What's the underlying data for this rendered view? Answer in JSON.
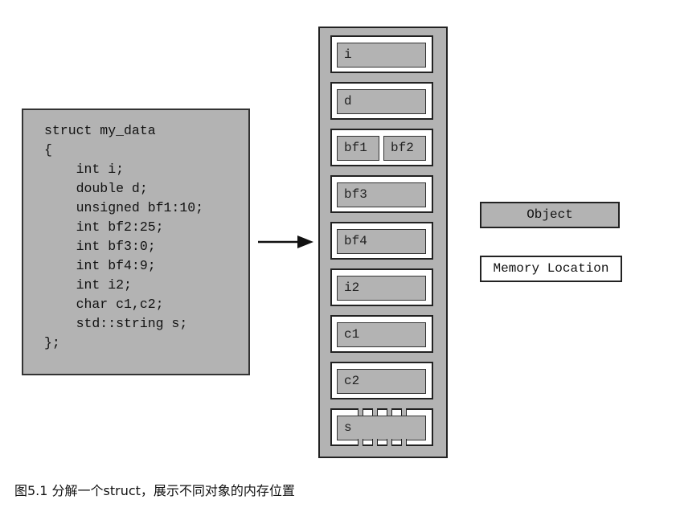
{
  "code_lines": [
    "struct my_data",
    "{",
    "    int i;",
    "    double d;",
    "    unsigned bf1:10;",
    "    int bf2:25;",
    "    int bf3:0;",
    "    int bf4:9;",
    "    int i2;",
    "    char c1,c2;",
    "    std::string s;",
    "};"
  ],
  "memory_slots": [
    [
      "i"
    ],
    [
      "d"
    ],
    [
      "bf1",
      "bf2"
    ],
    [
      "bf3"
    ],
    [
      "bf4"
    ],
    [
      "i2"
    ],
    [
      "c1"
    ],
    [
      "c2"
    ],
    [
      "s"
    ]
  ],
  "legend": {
    "object": "Object",
    "memory_location": "Memory Location"
  },
  "caption": "图5.1 分解一个struct，展示不同对象的内存位置",
  "colors": {
    "object_fill": "#b3b3b3",
    "memory_location_fill": "#ffffff"
  }
}
